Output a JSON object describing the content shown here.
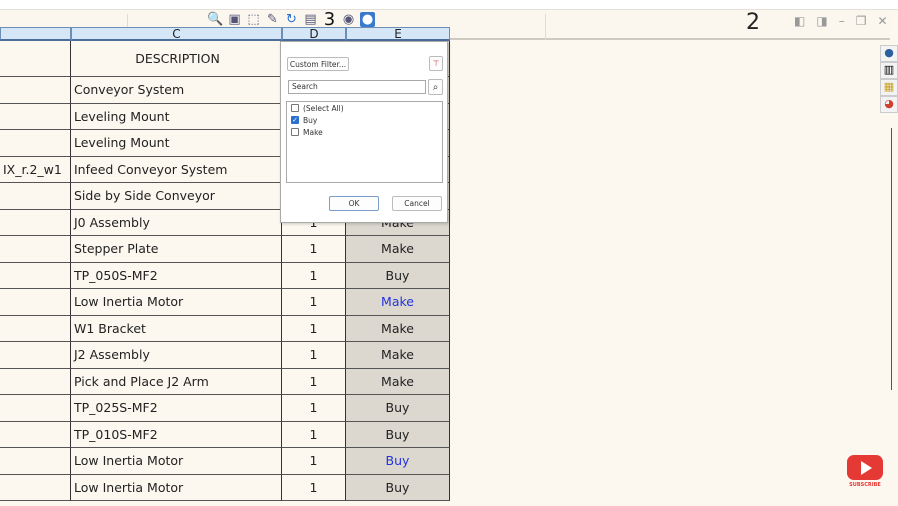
{
  "toolbar": {
    "tools": [
      "zoom-icon",
      "zoom-fit-icon",
      "zoom-area-icon",
      "pan-icon",
      "rotate-icon",
      "view-icon",
      "3",
      "eye-icon",
      "globe-icon"
    ],
    "sheet_number": "2"
  },
  "columns": [
    "C",
    "D",
    "E"
  ],
  "header": {
    "description": "DESCRIPTION"
  },
  "rows": [
    {
      "a": "",
      "c": "Conveyor System",
      "d": "",
      "e": ""
    },
    {
      "a": "",
      "c": "Leveling Mount",
      "d": "",
      "e": ""
    },
    {
      "a": "",
      "c": "Leveling Mount",
      "d": "",
      "e": ""
    },
    {
      "a": "IX_r.2_w1",
      "c": "Infeed Conveyor System",
      "d": "",
      "e": ""
    },
    {
      "a": "",
      "c": "Side by Side Conveyor",
      "d": "",
      "e": ""
    },
    {
      "a": "",
      "c": "J0 Assembly",
      "d": "1",
      "e": "Make"
    },
    {
      "a": "",
      "c": "Stepper Plate",
      "d": "1",
      "e": "Make"
    },
    {
      "a": "",
      "c": "TP_050S-MF2",
      "d": "1",
      "e": "Buy"
    },
    {
      "a": "",
      "c": "Low Inertia Motor",
      "d": "1",
      "e": "Make",
      "e_blue": true
    },
    {
      "a": "",
      "c": "W1 Bracket",
      "d": "1",
      "e": "Make"
    },
    {
      "a": "",
      "c": "J2 Assembly",
      "d": "1",
      "e": "Make"
    },
    {
      "a": "",
      "c": "Pick and Place J2 Arm",
      "d": "1",
      "e": "Make"
    },
    {
      "a": "",
      "c": "TP_025S-MF2",
      "d": "1",
      "e": "Buy"
    },
    {
      "a": "",
      "c": "TP_010S-MF2",
      "d": "1",
      "e": "Buy"
    },
    {
      "a": "",
      "c": "Low Inertia Motor",
      "d": "1",
      "e": "Buy",
      "e_blue": true
    },
    {
      "a": "",
      "c": "Low Inertia Motor",
      "d": "1",
      "e": "Buy"
    }
  ],
  "filter": {
    "custom_filter": "Custom Filter...",
    "search_placeholder": "Search",
    "options": [
      {
        "label": "(Select All)",
        "checked": false
      },
      {
        "label": "Buy",
        "checked": true
      },
      {
        "label": "Make",
        "checked": false
      }
    ],
    "ok": "OK",
    "cancel": "Cancel"
  },
  "youtube": {
    "label": "SUBSCRIBE",
    "color": "#e53935"
  }
}
